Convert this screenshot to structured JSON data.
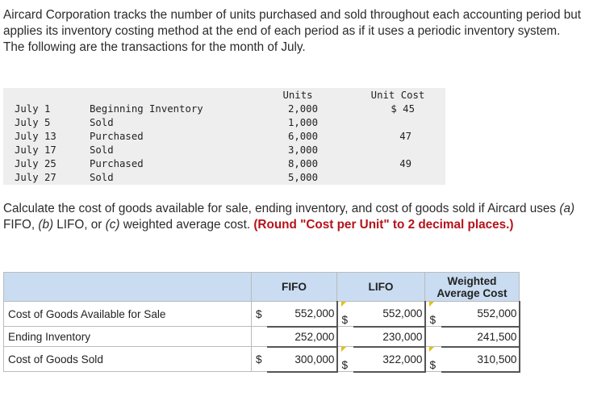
{
  "intro": "Aircard Corporation tracks the number of units purchased and sold throughout each accounting period but applies its inventory costing method at the end of each period as if it uses a periodic inventory system. The following are the transactions for the month of July.",
  "transactions": {
    "header_units": "Units",
    "header_cost": "Unit Cost",
    "rows": [
      {
        "date": "July 1",
        "desc": "Beginning Inventory",
        "units": "2,000",
        "cost": "$ 45"
      },
      {
        "date": "July 5",
        "desc": "Sold",
        "units": "1,000",
        "cost": ""
      },
      {
        "date": "July 13",
        "desc": "Purchased",
        "units": "6,000",
        "cost": "47"
      },
      {
        "date": "July 17",
        "desc": "Sold",
        "units": "3,000",
        "cost": ""
      },
      {
        "date": "July 25",
        "desc": "Purchased",
        "units": "8,000",
        "cost": "49"
      },
      {
        "date": "July 27",
        "desc": "Sold",
        "units": "5,000",
        "cost": ""
      }
    ]
  },
  "question": {
    "part1": "Calculate the cost of goods available for sale, ending inventory, and cost of goods sold if Aircard uses ",
    "a": "(a)",
    "fifo": " FIFO, ",
    "b": "(b)",
    "lifo": " LIFO, or ",
    "c": "(c)",
    "wac": " weighted average cost. ",
    "note": "(Round \"Cost per Unit\" to 2 decimal places.)"
  },
  "answer_table": {
    "headers": [
      "FIFO",
      "LIFO",
      "Weighted Average Cost"
    ],
    "rows": [
      {
        "label": "Cost of Goods Available for Sale",
        "fifo_cur": "$",
        "fifo": "552,000",
        "lifo_cur": "$",
        "lifo": "552,000",
        "wa_cur": "$",
        "wa": "552,000"
      },
      {
        "label": "Ending Inventory",
        "fifo_cur": "",
        "fifo": "252,000",
        "lifo_cur": "",
        "lifo": "230,000",
        "wa_cur": "",
        "wa": "241,500"
      },
      {
        "label": "Cost of Goods Sold",
        "fifo_cur": "$",
        "fifo": "300,000",
        "lifo_cur": "$",
        "lifo": "322,000",
        "wa_cur": "$",
        "wa": "310,500"
      }
    ]
  }
}
